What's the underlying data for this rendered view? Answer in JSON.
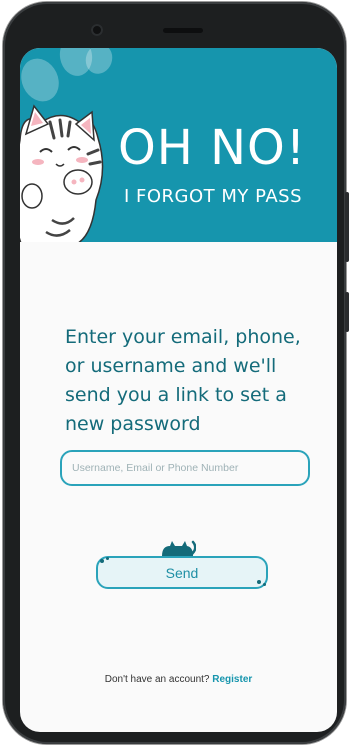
{
  "header": {
    "title": "OH NO!",
    "subtitle": "I FORGOT MY PASS"
  },
  "main": {
    "instructions": "Enter your email, phone, or username and we'll send you a link to set a new password",
    "input": {
      "placeholder": "Username, Email or Phone Number",
      "value": ""
    },
    "send_label": "Send"
  },
  "footer": {
    "prompt": "Don't have an account?",
    "register_label": "Register"
  },
  "colors": {
    "accent": "#1695ad",
    "text_dark": "#146b7a",
    "button_bg": "#e6f4f7"
  },
  "icons": [
    "cat-illustration-icon",
    "paw-print-icon",
    "sleeping-cat-icon"
  ]
}
